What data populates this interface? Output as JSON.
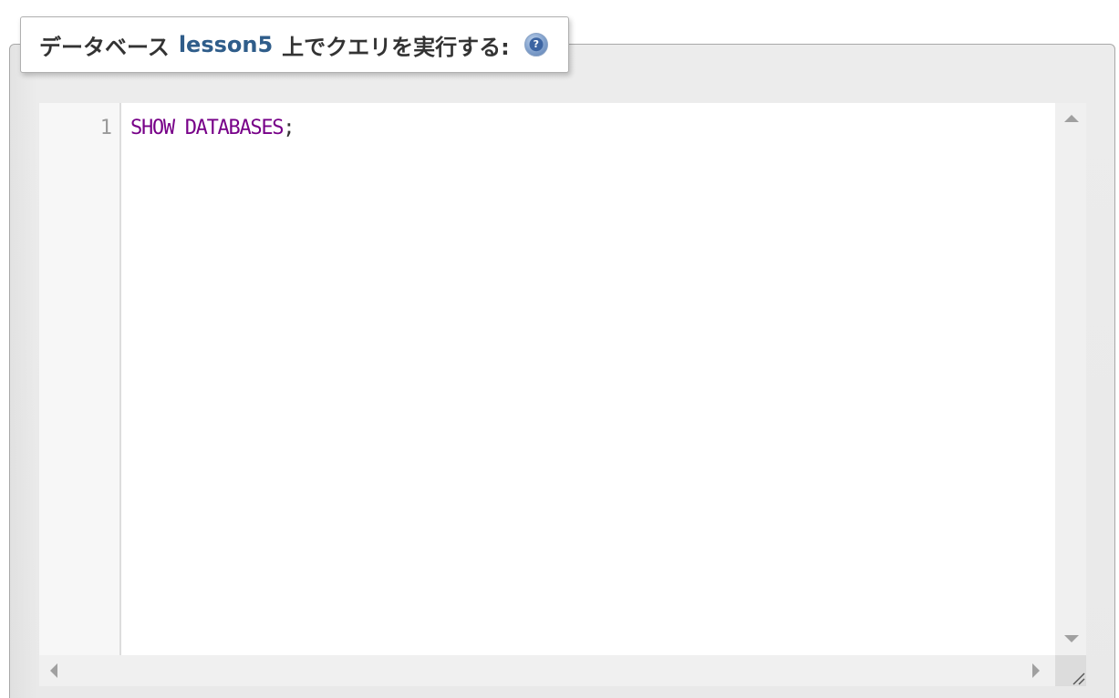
{
  "header": {
    "prefix": "データベース",
    "database_name": "lesson5",
    "suffix": "上でクエリを実行する:",
    "help_icon": "help-question-icon",
    "help_symbol": "?"
  },
  "editor": {
    "line_numbers": [
      "1"
    ],
    "lines": [
      {
        "keywords": "SHOW DATABASES",
        "punctuation": ";"
      }
    ],
    "colors": {
      "keyword": "#770088",
      "line_number": "#999999",
      "link": "#2f5d8a"
    }
  }
}
